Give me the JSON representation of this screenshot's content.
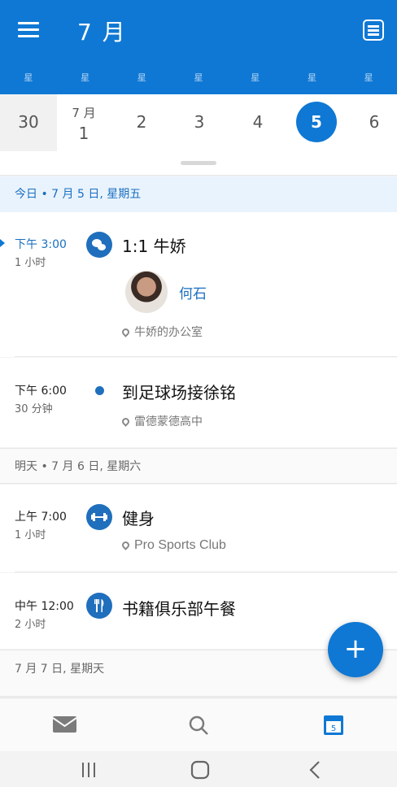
{
  "header": {
    "month_title": "7 月",
    "weekdays": [
      "星",
      "星",
      "星",
      "星",
      "星",
      "星",
      "星"
    ]
  },
  "date_strip": {
    "cells": [
      {
        "num": "30"
      },
      {
        "mon": "7 月",
        "num": "1"
      },
      {
        "num": "2"
      },
      {
        "num": "3"
      },
      {
        "num": "4"
      },
      {
        "num": "5"
      },
      {
        "num": "6"
      }
    ]
  },
  "days": [
    {
      "label": "今日 • 7 月 5 日, 星期五"
    },
    {
      "label": "明天 • 7 月 6 日, 星期六"
    },
    {
      "label": "7 月 7 日, 星期天"
    }
  ],
  "events": [
    {
      "time": "下午 3:00",
      "duration": "1 小时",
      "title": "1:1 牛娇",
      "attendee": "何石",
      "location": "牛娇的办公室",
      "icon": "chat-icon"
    },
    {
      "time": "下午 6:00",
      "duration": "30 分钟",
      "title": "到足球场接徐铭",
      "location": "雷德蒙德高中",
      "icon": "dot"
    },
    {
      "time": "上午 7:00",
      "duration": "1 小时",
      "title": "健身",
      "location": "Pro Sports Club",
      "icon": "dumbbell-icon"
    },
    {
      "time": "中午 12:00",
      "duration": "2 小时",
      "title": "书籍俱乐部午餐",
      "icon": "fork-knife-icon"
    }
  ],
  "fab": {
    "label": "+"
  },
  "colors": {
    "accent": "#0f78d4",
    "event_badge": "#1f6fbd"
  }
}
